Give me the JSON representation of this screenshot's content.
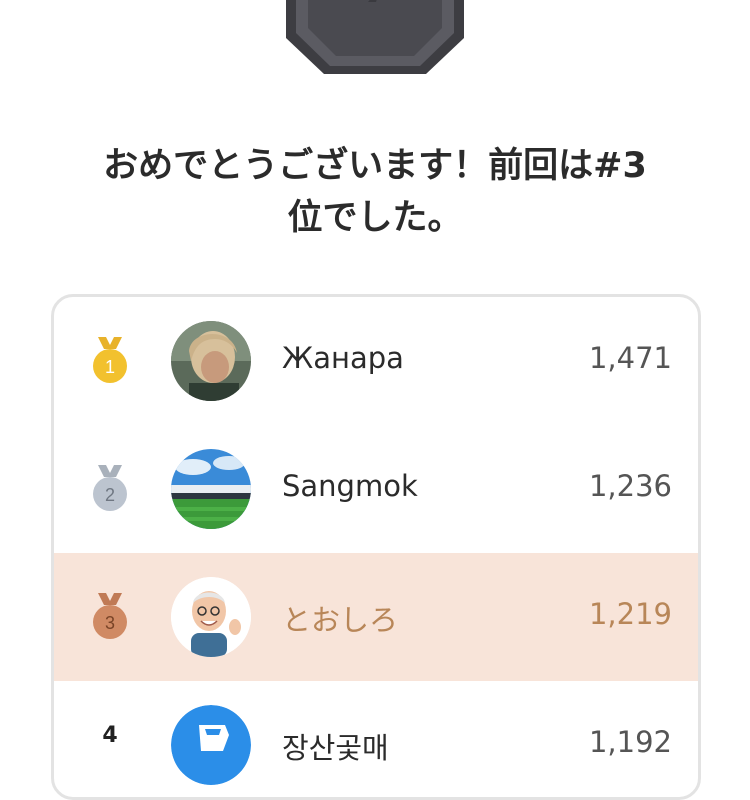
{
  "title": {
    "line1": "おめでとうございます！前回は#3",
    "line2": "位でした。"
  },
  "badge_icon": "hexagon-badge-icon",
  "leaderboard": [
    {
      "rank": "1",
      "medal": "gold",
      "medal_color": "#f2c12e",
      "name": "Жанара",
      "score": "1,471",
      "avatar": "photo-woman"
    },
    {
      "rank": "2",
      "medal": "silver",
      "medal_color": "#bcc4cf",
      "name": "Sangmok",
      "score": "1,236",
      "avatar": "photo-stadium"
    },
    {
      "rank": "3",
      "medal": "bronze",
      "medal_color": "#d08a64",
      "name": "とおしろ",
      "score": "1,219",
      "avatar": "memoji-man",
      "highlighted": true
    },
    {
      "rank": "4",
      "medal": "none",
      "name": "장산곷매",
      "score": "1,192",
      "avatar": "icon-blue"
    }
  ],
  "colors": {
    "highlight_bg": "#f8e4d9",
    "highlight_text": "#b88658",
    "badge": "#4f4f55"
  }
}
